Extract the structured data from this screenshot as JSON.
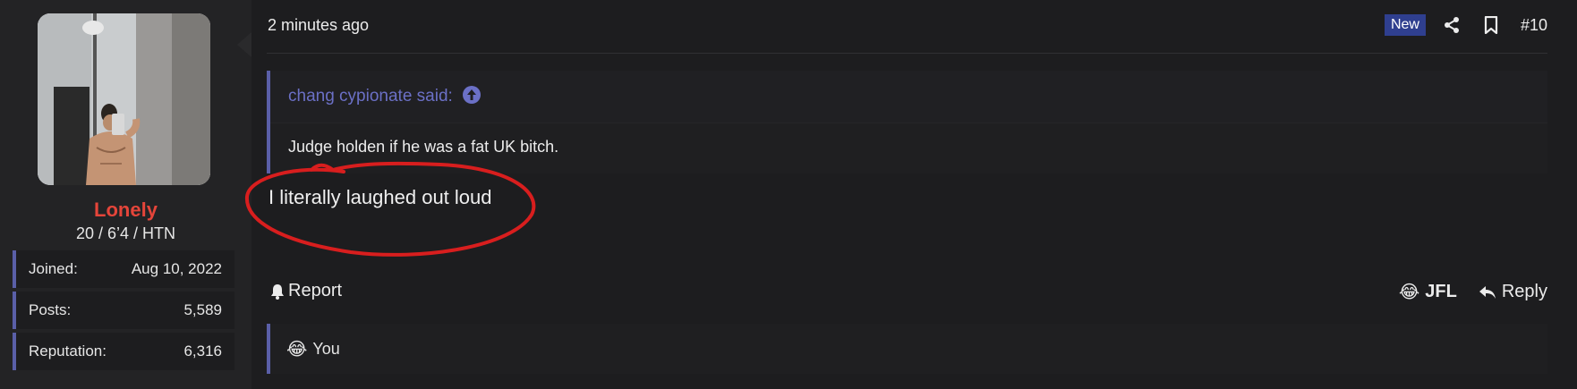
{
  "user": {
    "name": "Lonely",
    "title": "20 / 6’4 / HTN",
    "stats": [
      {
        "label": "Joined:",
        "value": "Aug 10, 2022"
      },
      {
        "label": "Posts:",
        "value": "5,589"
      },
      {
        "label": "Reputation:",
        "value": "6,316"
      }
    ]
  },
  "header": {
    "time": "2 minutes ago",
    "badge": "New",
    "post_number": "#10"
  },
  "quote": {
    "author": "chang cypionate said:",
    "text": "Judge holden if he was a fat UK bitch."
  },
  "message": "I literally laughed out loud",
  "footer": {
    "report": "Report",
    "reaction_emoji": "😂",
    "reaction_label": "JFL",
    "reply": "Reply"
  },
  "reactions": {
    "emoji": "😂",
    "text": "You"
  },
  "colors": {
    "username": "#e5453a",
    "accent": "#5a5fa8",
    "quote_author": "#6b70c6",
    "annotation": "#d81e1e"
  }
}
